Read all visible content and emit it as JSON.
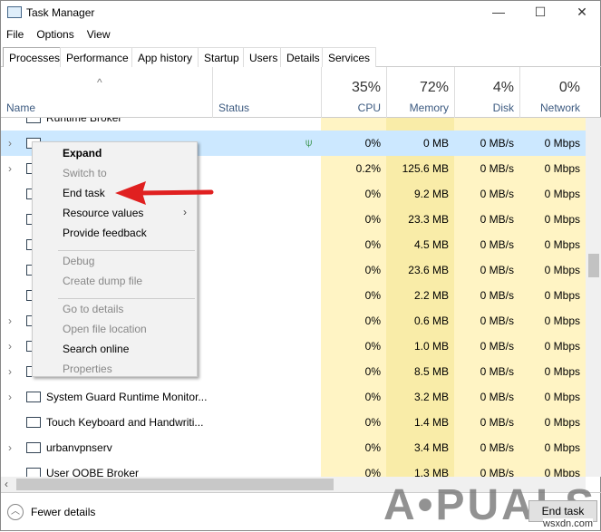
{
  "window": {
    "title": "Task Manager",
    "minimize": "—",
    "maximize": "☐",
    "close": "✕"
  },
  "menubar": [
    "File",
    "Options",
    "View"
  ],
  "tabs": [
    "Processes",
    "Performance",
    "App history",
    "Startup",
    "Users",
    "Details",
    "Services"
  ],
  "header": {
    "name": "Name",
    "status": "Status",
    "cpu_pct": "35%",
    "cpu": "CPU",
    "mem_pct": "72%",
    "mem": "Memory",
    "disk_pct": "4%",
    "disk": "Disk",
    "net_pct": "0%",
    "net": "Network"
  },
  "rows": [
    {
      "name": "Runtime Broker",
      "expand": false,
      "cpu": "",
      "mem": "",
      "disk": "",
      "net": ""
    },
    {
      "name": "",
      "expand": true,
      "selected": true,
      "status_icon": "leaf-icon",
      "cpu": "0%",
      "mem": "0 MB",
      "disk": "0 MB/s",
      "net": "0 Mbps"
    },
    {
      "name": "",
      "expand": true,
      "cpu": "0.2%",
      "mem": "125.6 MB",
      "disk": "0 MB/s",
      "net": "0 Mbps"
    },
    {
      "name": "",
      "expand": false,
      "cpu": "0%",
      "mem": "9.2 MB",
      "disk": "0 MB/s",
      "net": "0 Mbps"
    },
    {
      "name": "",
      "expand": false,
      "cpu": "0%",
      "mem": "23.3 MB",
      "disk": "0 MB/s",
      "net": "0 Mbps"
    },
    {
      "name": "",
      "expand": false,
      "cpu": "0%",
      "mem": "4.5 MB",
      "disk": "0 MB/s",
      "net": "0 Mbps"
    },
    {
      "name": "",
      "expand": false,
      "cpu": "0%",
      "mem": "23.6 MB",
      "disk": "0 MB/s",
      "net": "0 Mbps"
    },
    {
      "name": "",
      "expand": false,
      "cpu": "0%",
      "mem": "2.2 MB",
      "disk": "0 MB/s",
      "net": "0 Mbps"
    },
    {
      "name": "",
      "expand": true,
      "cpu": "0%",
      "mem": "0.6 MB",
      "disk": "0 MB/s",
      "net": "0 Mbps"
    },
    {
      "name": "",
      "expand": true,
      "cpu": "0%",
      "mem": "1.0 MB",
      "disk": "0 MB/s",
      "net": "0 Mbps"
    },
    {
      "name": "",
      "expand": true,
      "cpu": "0%",
      "mem": "8.5 MB",
      "disk": "0 MB/s",
      "net": "0 Mbps"
    },
    {
      "name": "System Guard Runtime Monitor...",
      "expand": true,
      "cpu": "0%",
      "mem": "3.2 MB",
      "disk": "0 MB/s",
      "net": "0 Mbps"
    },
    {
      "name": "Touch Keyboard and Handwriti...",
      "expand": false,
      "cpu": "0%",
      "mem": "1.4 MB",
      "disk": "0 MB/s",
      "net": "0 Mbps"
    },
    {
      "name": "urbanvpnserv",
      "expand": true,
      "cpu": "0%",
      "mem": "3.4 MB",
      "disk": "0 MB/s",
      "net": "0 Mbps"
    },
    {
      "name": "User OOBE Broker",
      "expand": false,
      "cpu": "0%",
      "mem": "1.3 MB",
      "disk": "0 MB/s",
      "net": "0 Mbps"
    }
  ],
  "context_menu": [
    {
      "label": "Expand",
      "bold": true
    },
    {
      "label": "Switch to",
      "disabled": true
    },
    {
      "label": "End task"
    },
    {
      "label": "Resource values",
      "submenu": true
    },
    {
      "label": "Provide feedback"
    },
    {
      "sep": true
    },
    {
      "label": "Debug",
      "disabled": true
    },
    {
      "label": "Create dump file",
      "disabled": true
    },
    {
      "sep": true
    },
    {
      "label": "Go to details",
      "disabled": true
    },
    {
      "label": "Open file location",
      "disabled": true
    },
    {
      "label": "Search online"
    },
    {
      "label": "Properties",
      "disabled": true
    }
  ],
  "footer": {
    "fewer_details": "Fewer details",
    "end_task": "End task"
  },
  "watermark": "APPUALS",
  "watermark2": "wsxdn.com",
  "colors": {
    "selected": "#cce8ff",
    "heat_light": "#fff4c4",
    "heat_mid": "#f9eca8",
    "arrow": "#e02020"
  }
}
